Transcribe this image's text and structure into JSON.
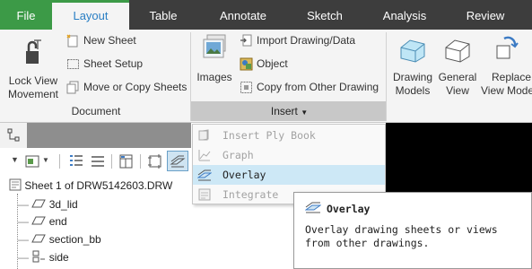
{
  "tabs": [
    {
      "label": "File"
    },
    {
      "label": "Layout"
    },
    {
      "label": "Table"
    },
    {
      "label": "Annotate"
    },
    {
      "label": "Sketch"
    },
    {
      "label": "Analysis"
    },
    {
      "label": "Review"
    }
  ],
  "active_tab": "Layout",
  "colors": {
    "file_tab": "#3c9a47",
    "active_tab_text": "#2a7fc4",
    "tab_bar": "#3d3d3d",
    "hover": "#cde8f6"
  },
  "ribbon": {
    "document_group": {
      "label": "Document",
      "lock_view_movement": "Lock View Movement",
      "lock_line1": "Lock View",
      "lock_line2": "Movement",
      "new_sheet": "New Sheet",
      "sheet_setup": "Sheet Setup",
      "move_copy_sheets": "Move or Copy Sheets"
    },
    "insert_group": {
      "label": "Insert",
      "images": "Images",
      "import_drawing": "Import Drawing/Data",
      "object": "Object",
      "copy_from_other": "Copy from Other Drawing"
    },
    "models_group": {
      "drawing_models_1": "Drawing",
      "drawing_models_2": "Models",
      "general_view_1": "General",
      "general_view_2": "View",
      "replace_view_1": "Replace",
      "replace_view_2": "View Mode"
    }
  },
  "insert_menu": {
    "items": [
      {
        "label": "Insert Ply Book",
        "state": "disabled"
      },
      {
        "label": "Graph",
        "state": "disabled"
      },
      {
        "label": "Overlay",
        "state": "hover"
      },
      {
        "label": "Integrate",
        "state": "disabled"
      }
    ]
  },
  "tooltip": {
    "title": "Overlay",
    "line1": "Overlay drawing sheets or views",
    "line2": "from other drawings."
  },
  "tree": {
    "root": "Sheet 1 of DRW5142603.DRW",
    "items": [
      "3d_lid",
      "end",
      "section_bb",
      "side"
    ]
  }
}
